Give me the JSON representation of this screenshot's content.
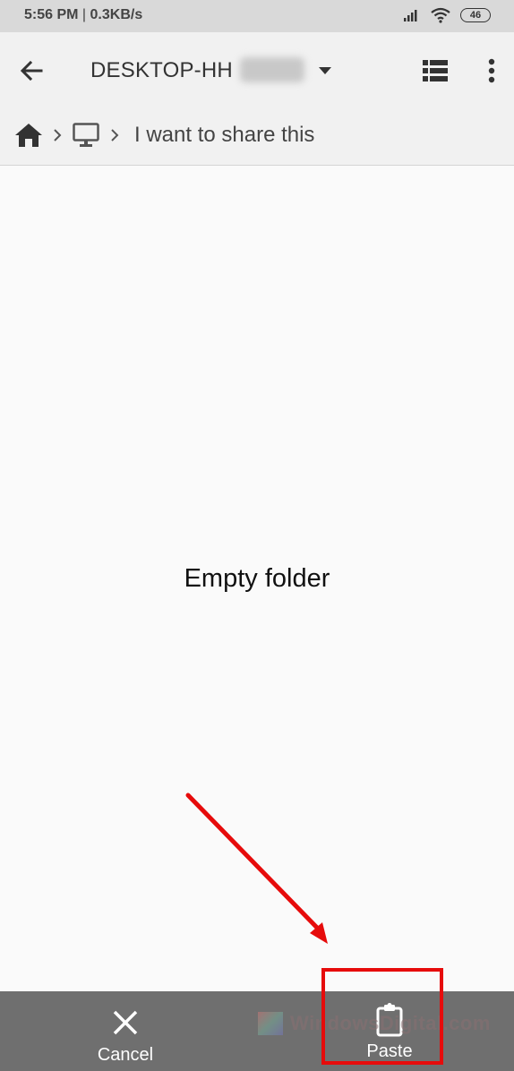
{
  "status_bar": {
    "time": "5:56 PM",
    "network_speed": "0.3KB/s",
    "separator": " | ",
    "battery": "46",
    "icons": [
      "signal-icon",
      "wifi-icon",
      "battery-icon"
    ]
  },
  "app_bar": {
    "title": "DESKTOP-HH",
    "title_redacted": true,
    "icons": {
      "back": "arrow-back-icon",
      "dropdown": "dropdown-triangle-icon",
      "view": "list-view-icon",
      "more": "more-vert-icon"
    }
  },
  "breadcrumb": {
    "items": [
      {
        "type": "icon",
        "icon": "home-icon"
      },
      {
        "type": "icon",
        "icon": "computer-icon"
      },
      {
        "type": "text",
        "label": "I want to share this"
      }
    ],
    "separator_icon": "chevron-right-icon"
  },
  "content": {
    "empty_message": "Empty folder"
  },
  "bottom_bar": {
    "actions": [
      {
        "label": "Cancel",
        "icon": "close-icon"
      },
      {
        "label": "Paste",
        "icon": "clipboard-icon"
      }
    ]
  },
  "watermark": {
    "text": "WindowsDigital.com"
  },
  "annotation": {
    "color": "#e60b0b",
    "target": "Paste"
  }
}
